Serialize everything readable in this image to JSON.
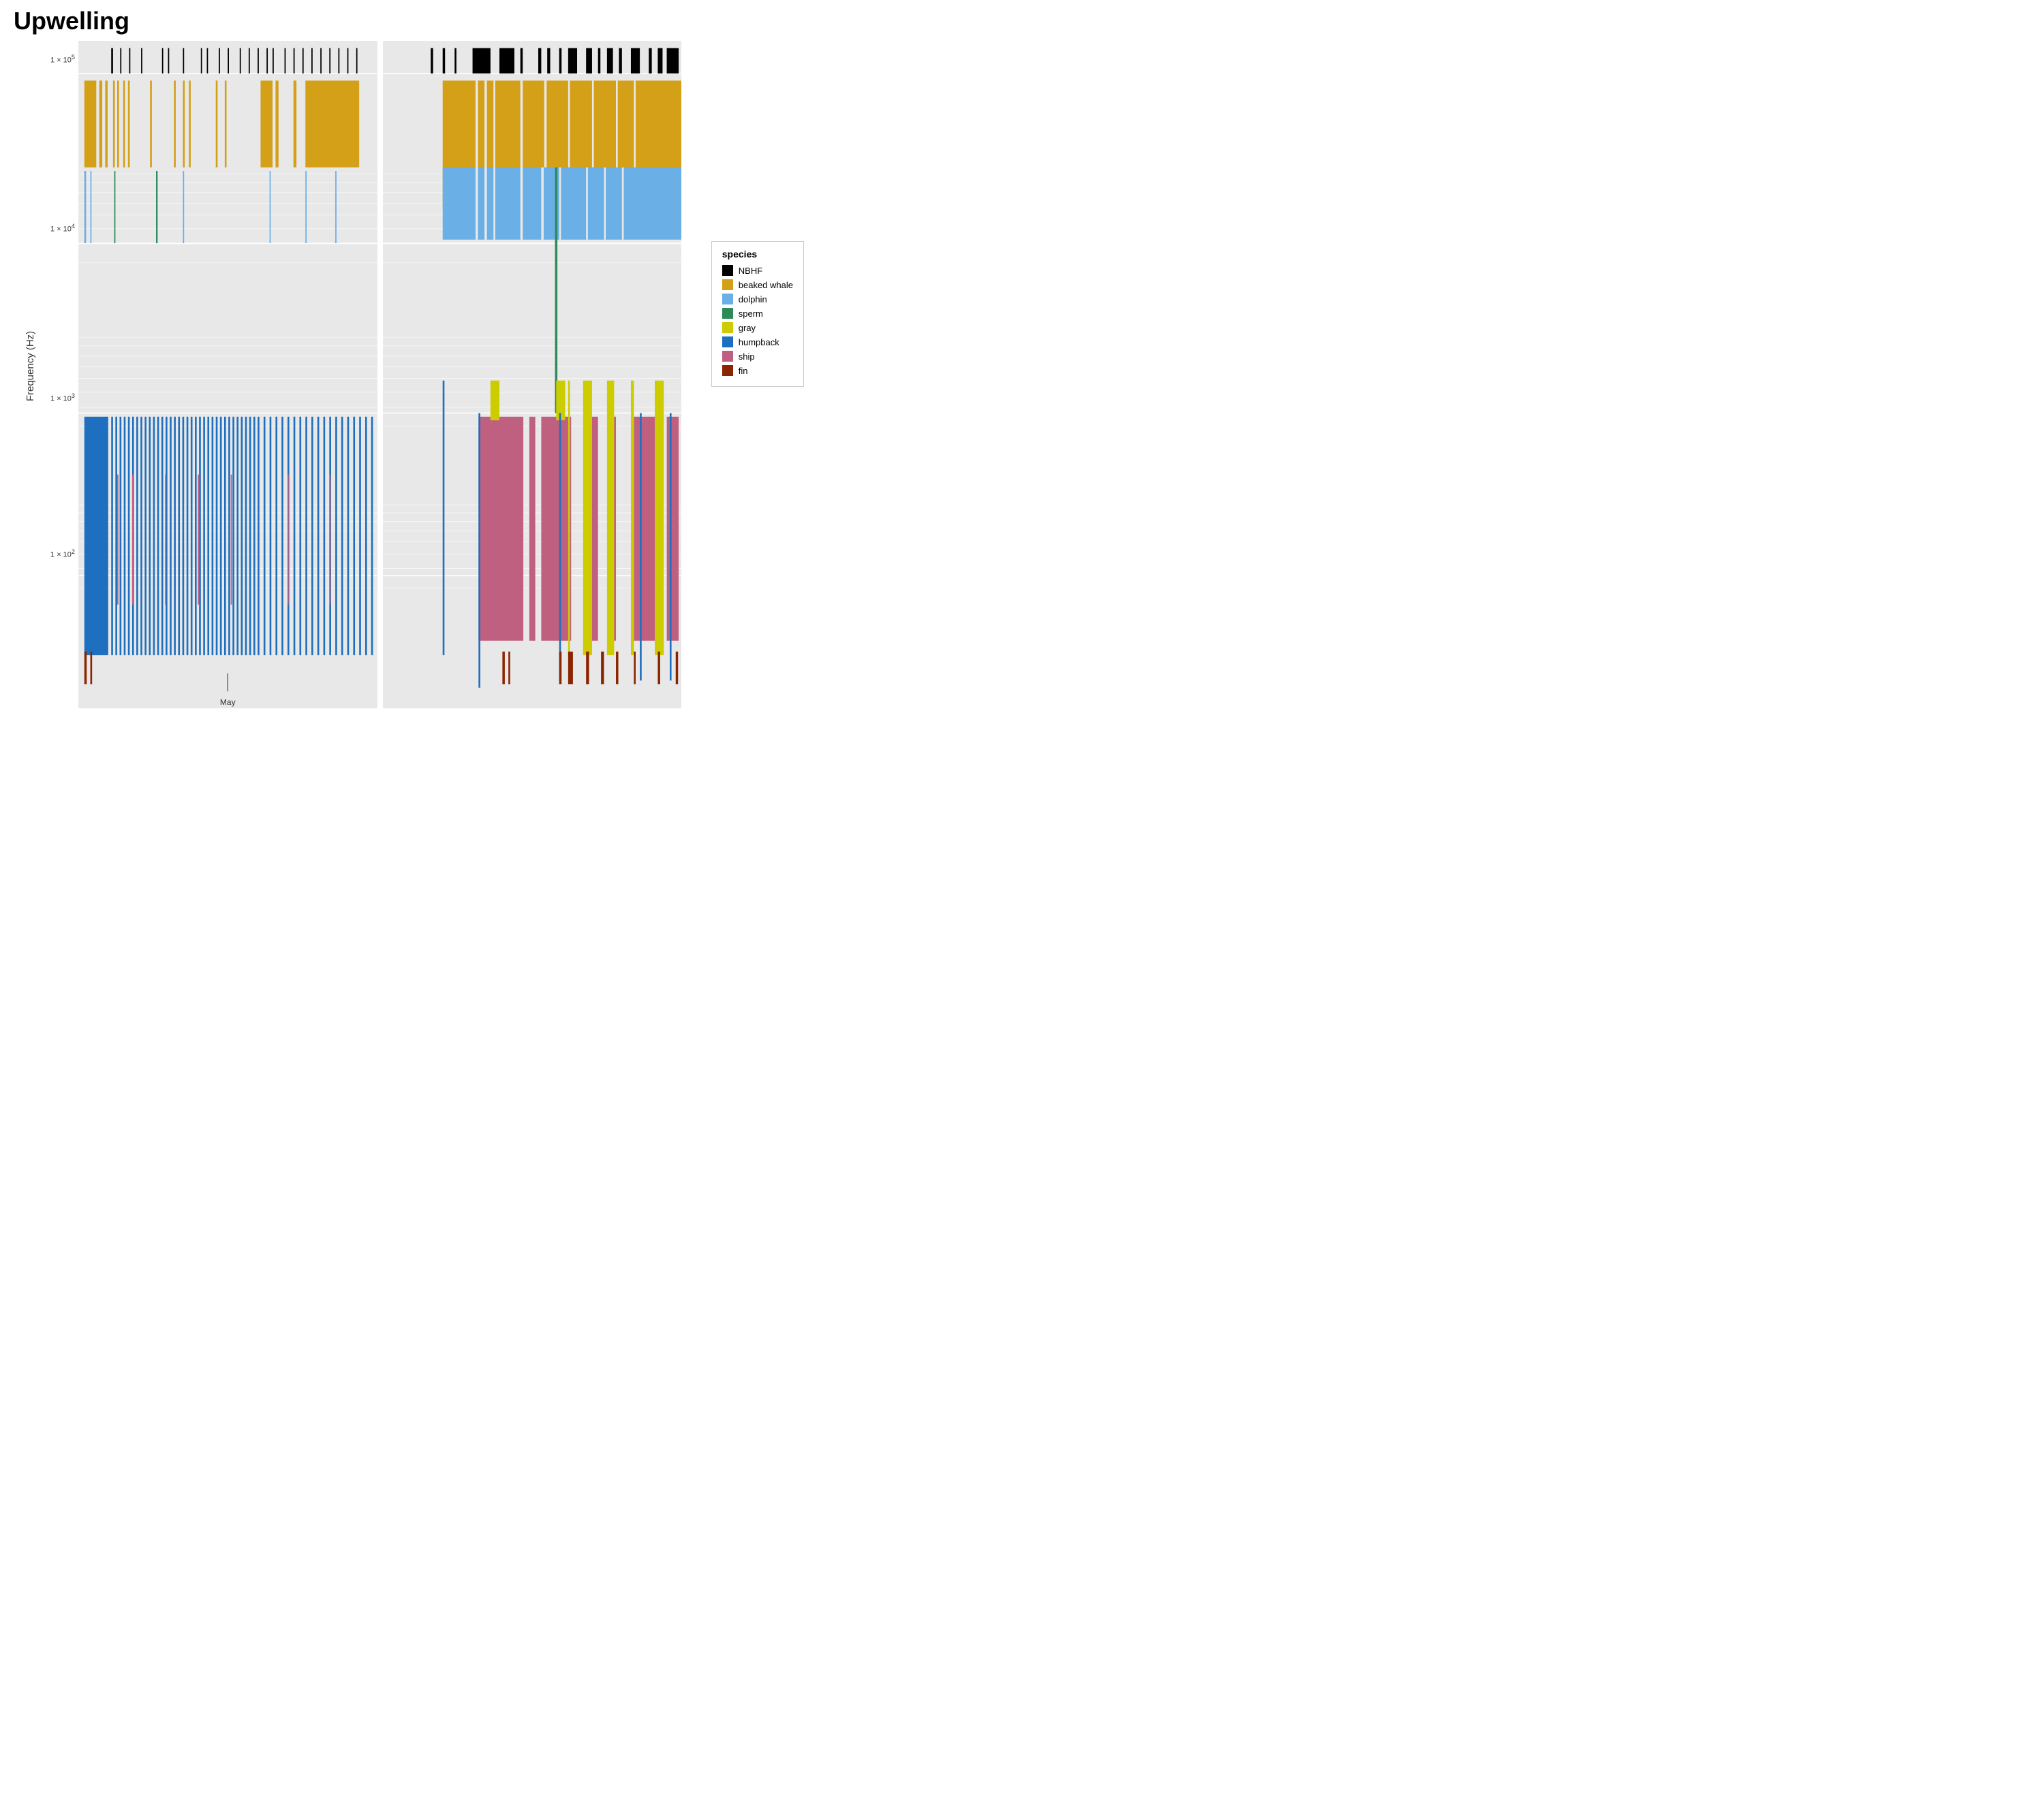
{
  "title": "Upwelling",
  "yAxisLabel": "Frequency (Hz)",
  "xLabel": "May",
  "legend": {
    "title": "species",
    "items": [
      {
        "label": "NBHF",
        "color": "#000000"
      },
      {
        "label": "beaked whale",
        "color": "#D4A017"
      },
      {
        "label": "dolphin",
        "color": "#6AAFE6"
      },
      {
        "label": "sperm",
        "color": "#2E8B57"
      },
      {
        "label": "gray",
        "color": "#CCCC00"
      },
      {
        "label": "humpback",
        "color": "#1E6FBF"
      },
      {
        "label": "ship",
        "color": "#C06080"
      },
      {
        "label": "fin",
        "color": "#8B2500"
      }
    ]
  },
  "yAxisTicks": [
    {
      "label": "1 × 10⁵",
      "pct": 2
    },
    {
      "label": "1 × 10⁴",
      "pct": 30
    },
    {
      "label": "1 × 10³",
      "pct": 58
    },
    {
      "label": "1 × 10²",
      "pct": 82
    }
  ]
}
